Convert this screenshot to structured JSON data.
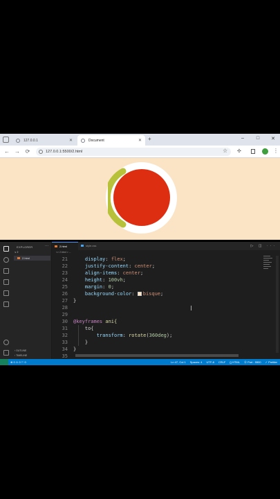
{
  "browser": {
    "tabs": [
      {
        "title": "127.0.0.1",
        "active": false
      },
      {
        "title": "Document",
        "active": true
      }
    ],
    "new_tab_label": "+",
    "window_controls": {
      "minimize": "–",
      "maximize": "□",
      "close": "✕"
    },
    "nav": {
      "back": "←",
      "forward": "→",
      "reload": "⟳"
    },
    "url": "127.0.0.1:5500/2.html",
    "star": "☆",
    "extensions": "✣",
    "profile_initial": "",
    "menu": "⋮"
  },
  "page": {
    "background": "#fbe4c6",
    "ring_color": "#ffffff",
    "arc_color": "#b7c23a",
    "ball_color": "#dd2e12"
  },
  "vscode": {
    "explorer_title": "EXPLORER",
    "explorer_more": "···",
    "folder_label": "∨ 2",
    "file_item": "2.html",
    "outline_label": "› OUTLINE",
    "timeline_label": "› TIMELINE",
    "tabs": [
      {
        "label": "2.html",
        "active": true
      },
      {
        "label": "style.css",
        "active": false
      }
    ],
    "editor_actions": "▷ ◫ ···",
    "breadcrumb": "<> 2.html > ...",
    "lines": [
      {
        "n": "21",
        "indent": "    ",
        "prop": "display",
        "value": "flex",
        "kind": "val"
      },
      {
        "n": "22",
        "indent": "    ",
        "prop": "justify-content",
        "value": "center",
        "kind": "val"
      },
      {
        "n": "23",
        "indent": "    ",
        "prop": "align-items",
        "value": "center",
        "kind": "val"
      },
      {
        "n": "24",
        "indent": "    ",
        "prop": "height",
        "value": "100vh",
        "kind": "num"
      },
      {
        "n": "25",
        "indent": "    ",
        "prop": "margin",
        "value": "0",
        "kind": "num"
      },
      {
        "n": "26",
        "indent": "    ",
        "prop": "background-color",
        "value": "bisque",
        "kind": "val"
      },
      {
        "n": "27",
        "text": "}"
      },
      {
        "n": "28",
        "text": ""
      },
      {
        "n": "29",
        "text": ""
      },
      {
        "n": "30",
        "at": "@keyframes",
        "name": " ani{"
      },
      {
        "n": "31",
        "text": "    to{"
      },
      {
        "n": "32",
        "indent": "        ",
        "prop": "transform",
        "fn": "rotate",
        "arg": "360deg"
      },
      {
        "n": "33",
        "text": "    }"
      },
      {
        "n": "34",
        "text": "}"
      },
      {
        "n": "35",
        "text": ""
      }
    ],
    "status": {
      "left": "⊗ 0 ⚠ 0   ⚐ 0",
      "items": [
        "Ln 47, Col 1",
        "Spaces: 4",
        "UTF-8",
        "CRLF",
        "{} HTML",
        "⦿ Port : 5500",
        "✓ Prettier"
      ]
    }
  }
}
